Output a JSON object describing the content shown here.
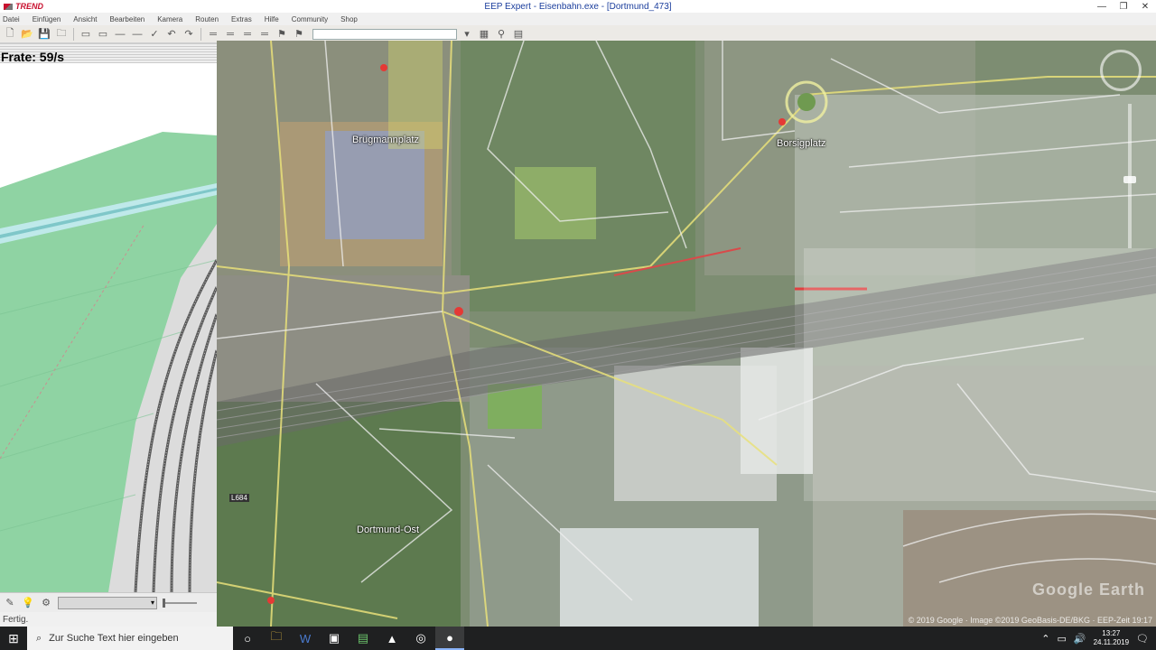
{
  "window": {
    "brand": "TREND",
    "title": "EEP Expert - Eisenbahn.exe - [Dortmund_473]",
    "controls": [
      "—",
      "❐",
      "✕"
    ]
  },
  "menu": [
    "Datei",
    "Einfügen",
    "Ansicht",
    "Bearbeiten",
    "Kamera",
    "Routen",
    "Extras",
    "Hilfe",
    "Community",
    "Shop"
  ],
  "toolbar": {
    "left_icons": [
      "new-icon",
      "open-icon",
      "save-icon",
      "folder-icon",
      "window-icon",
      "window2-icon",
      "line-icon",
      "line2-icon",
      "check-icon",
      "undo-icon",
      "redo-icon"
    ],
    "right_icons": [
      "track-icon",
      "track2-icon",
      "track3-icon",
      "track4-icon",
      "signal-icon",
      "signal2-icon"
    ],
    "search_value": ""
  },
  "left_panel": {
    "frame_rate": "Frate: 59/s"
  },
  "map": {
    "labels": [
      {
        "text": "Borsigplatz"
      },
      {
        "text": "Brügmannplatz"
      },
      {
        "text": "Dortmund-Ost"
      }
    ],
    "road_tag": "L684",
    "watermark": "Google Earth",
    "copyright": "© 2019 Google · Image ©2019 GeoBasis-DE/BKG · EEP-Zeit 19:17"
  },
  "controls_bar": {
    "combo_value": ""
  },
  "status": {
    "text": "Fertig."
  },
  "taskbar": {
    "search_placeholder": "Zur Suche Text hier eingeben",
    "apps": [
      "taskview-icon",
      "explorer-icon",
      "word-icon",
      "app1-icon",
      "app2-icon",
      "photos-icon",
      "app3-icon",
      "eep-icon"
    ],
    "time": "13:27",
    "date": "24.11.2019"
  }
}
